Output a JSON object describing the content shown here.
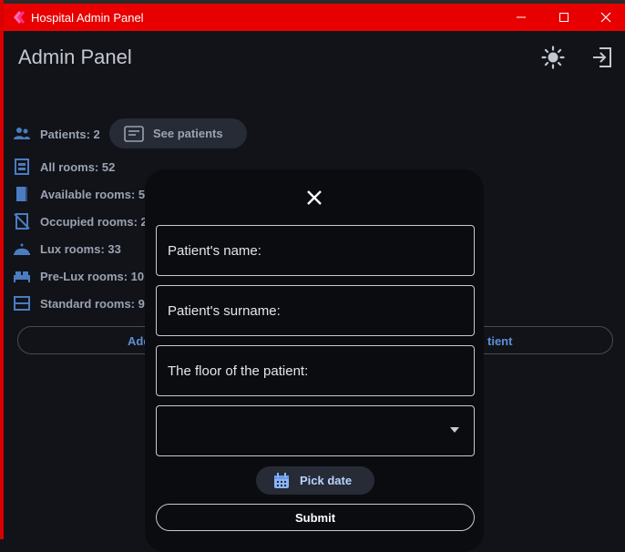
{
  "window": {
    "title": "Hospital Admin Panel",
    "controls": [
      "minimize",
      "maximize",
      "close"
    ]
  },
  "header": {
    "title": "Admin Panel",
    "theme_icon": "sun-icon",
    "logout_icon": "logout-icon"
  },
  "stats": {
    "patients": "Patients: 2",
    "see_patients": "See patients",
    "all_rooms": "All rooms: 52",
    "available_rooms": "Available rooms: 5",
    "occupied_rooms": "Occupied rooms: 2",
    "lux_rooms": "Lux rooms: 33",
    "pre_lux_rooms": "Pre-Lux rooms: 10",
    "standard_rooms": "Standard rooms: 9"
  },
  "actions": {
    "add_label": "Add",
    "patient_label": "tient"
  },
  "dialog": {
    "name_placeholder": "Patient's name:",
    "surname_placeholder": "Patient's surname:",
    "floor_placeholder": "The floor of the patient:",
    "dropdown_value": "",
    "pick_date": "Pick date",
    "submit": "Submit"
  },
  "colors": {
    "titlebar": "#e80000",
    "background": "#111318",
    "dialog": "#0a0c10",
    "accent": "#5d8fd6"
  }
}
